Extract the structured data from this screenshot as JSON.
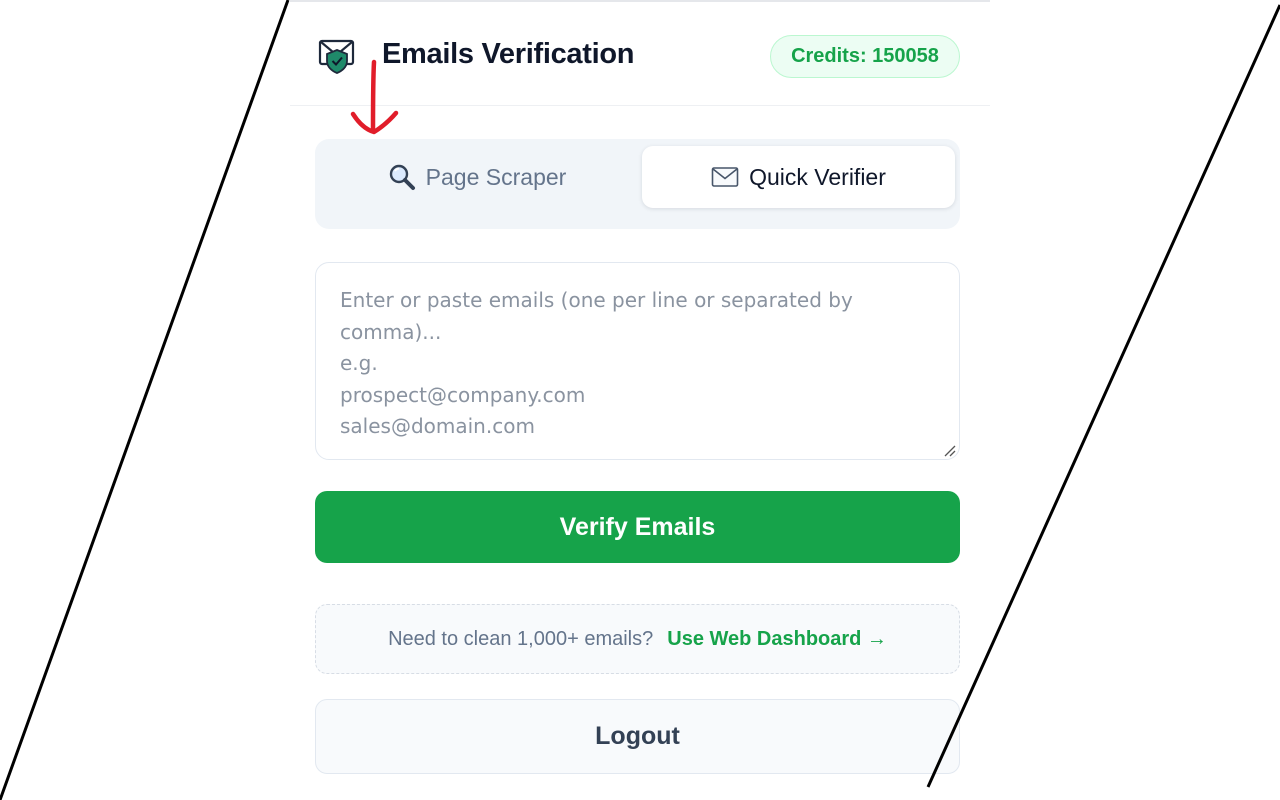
{
  "app": {
    "title": "Emails Verification",
    "credits_label": "Credits: 150058"
  },
  "tabs": [
    {
      "label": "Page Scraper",
      "icon": "magnifier-icon",
      "active": false
    },
    {
      "label": "Quick Verifier",
      "icon": "envelope-icon",
      "active": true
    }
  ],
  "email_input": {
    "value": "",
    "placeholder": "Enter or paste emails (one per line or separated by comma)...\ne.g.\nprospect@company.com\nsales@domain.com"
  },
  "verify_button": {
    "label": "Verify Emails"
  },
  "dashboard_promo": {
    "question": "Need to clean 1,000+ emails?",
    "link_label": "Use Web Dashboard →"
  },
  "logout_button": {
    "label": "Logout"
  },
  "colors": {
    "accent": "#16a34a",
    "credits_bg": "#ecfdf3",
    "annotation_arrow": "#e11d2a",
    "text_dark": "#0f172a",
    "text_muted": "#64748b"
  }
}
